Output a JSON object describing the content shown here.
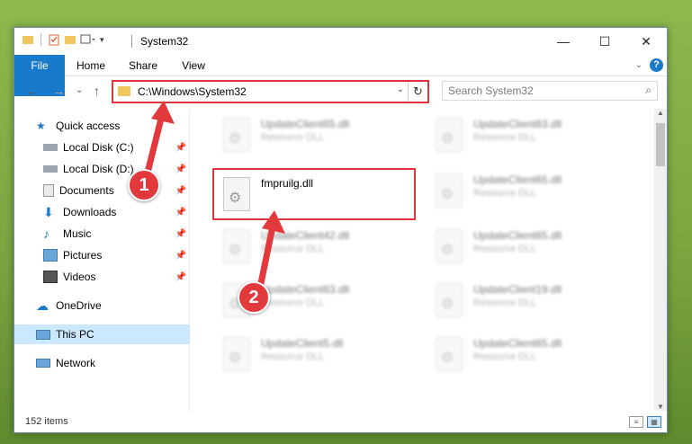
{
  "window": {
    "title": "System32",
    "controls": {
      "minimize": "—",
      "maximize": "☐",
      "close": "✕"
    }
  },
  "ribbon": {
    "tabs": [
      "File",
      "Home",
      "Share",
      "View"
    ]
  },
  "nav": {
    "back": "←",
    "forward": "→",
    "recent": "⌄",
    "up": "↑",
    "address": "C:\\Windows\\System32",
    "search_placeholder": "Search System32"
  },
  "sidebar": {
    "items": [
      {
        "label": "Quick access",
        "icon": "star-icon",
        "pinned": false
      },
      {
        "label": "Local Disk (C:)",
        "icon": "drive-icon",
        "pinned": true
      },
      {
        "label": "Local Disk (D:)",
        "icon": "drive-icon",
        "pinned": true
      },
      {
        "label": "Documents",
        "icon": "documents-icon",
        "pinned": true
      },
      {
        "label": "Downloads",
        "icon": "download-icon",
        "pinned": true
      },
      {
        "label": "Music",
        "icon": "music-icon",
        "pinned": true
      },
      {
        "label": "Pictures",
        "icon": "pictures-icon",
        "pinned": true
      },
      {
        "label": "Videos",
        "icon": "videos-icon",
        "pinned": true
      },
      {
        "label": "OneDrive",
        "icon": "cloud-icon",
        "pinned": false
      },
      {
        "label": "This PC",
        "icon": "computer-icon",
        "pinned": false,
        "selected": true
      },
      {
        "label": "Network",
        "icon": "network-icon",
        "pinned": false
      }
    ]
  },
  "files": {
    "left_column": [
      {
        "name": "UpdateClient65.dll",
        "type": "Resource DLL"
      },
      {
        "name": "fmpruilg.dll",
        "type": ""
      },
      {
        "name": "UpdateClient42.dll",
        "type": "Resource DLL"
      },
      {
        "name": "UpdateClient63.dll",
        "type": "Resource DLL"
      },
      {
        "name": "UpdateClient5.dll",
        "type": "Resource DLL"
      }
    ],
    "right_column": [
      {
        "name": "UpdateClient63.dll",
        "type": "Resource DLL"
      },
      {
        "name": "UpdateClient65.dll",
        "type": "Resource DLL"
      },
      {
        "name": "UpdateClient65.dll",
        "type": "Resource DLL"
      },
      {
        "name": "UpdateClient19.dll",
        "type": "Resource DLL"
      },
      {
        "name": "UpdateClient65.dll",
        "type": "Resource DLL"
      }
    ]
  },
  "status": {
    "item_count": "152 items"
  },
  "annotations": {
    "step1": "1",
    "step2": "2"
  },
  "colors": {
    "accent": "#1979ca",
    "highlight": "#d9373b",
    "badge": "#e2393d"
  }
}
